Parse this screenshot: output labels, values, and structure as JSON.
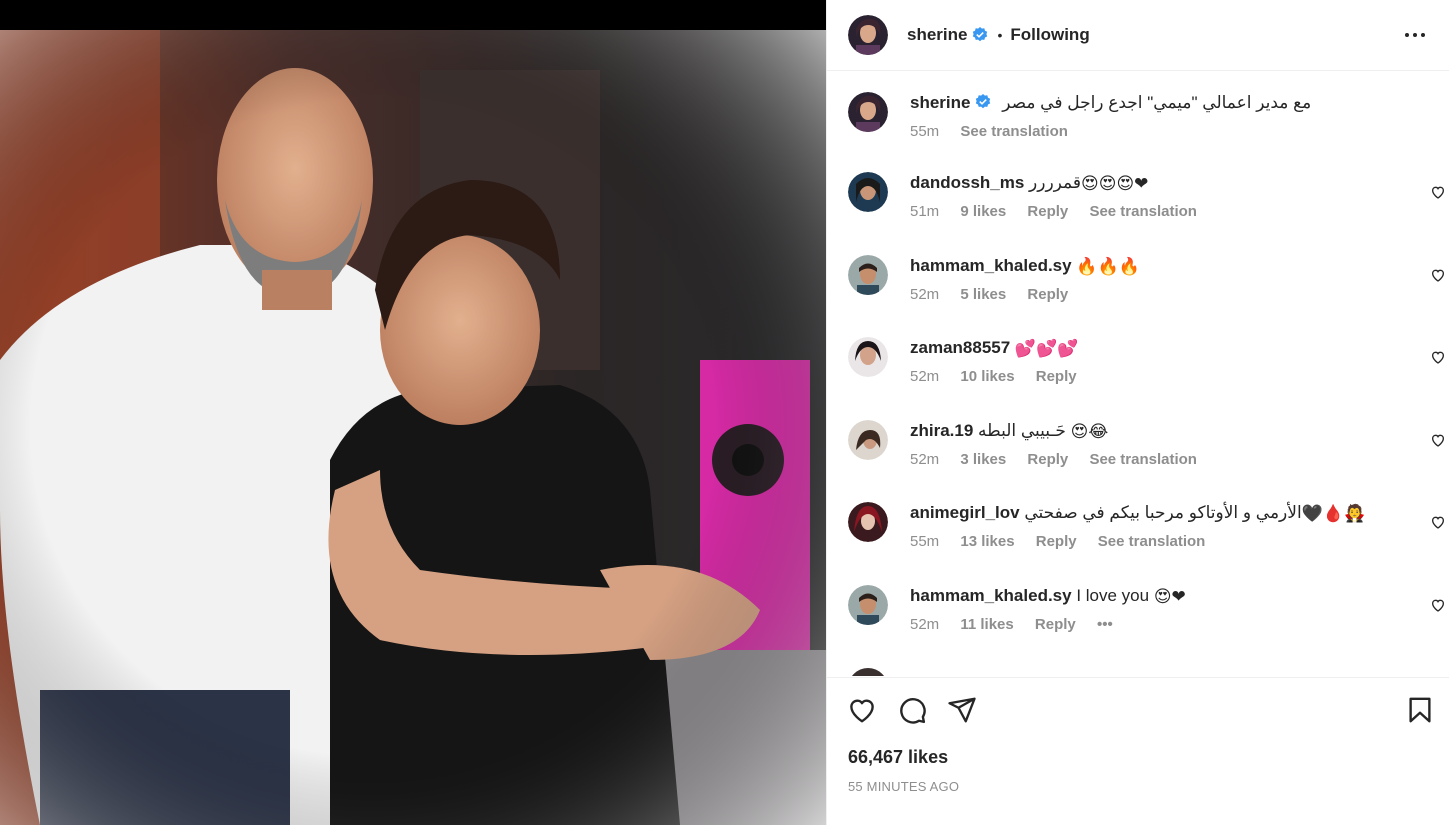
{
  "post": {
    "username": "sherine",
    "follow_status": "Following",
    "separator": "•",
    "caption": "مع مدير اعمالي \"ميمي\" اجدع راجل في مصر",
    "caption_time": "55m",
    "see_translation": "See translation",
    "likes": "66,467 likes",
    "posted_ago": "55 MINUTES AGO"
  },
  "comments": [
    {
      "user": "dandossh_ms",
      "text": "قمرررر",
      "emoji": "😍😍😍❤",
      "time": "51m",
      "likes": "9 likes",
      "reply": "Reply",
      "translate": "See translation"
    },
    {
      "user": "hammam_khaled.sy",
      "text": "",
      "emoji": "🔥🔥🔥",
      "time": "52m",
      "likes": "5 likes",
      "reply": "Reply",
      "translate": ""
    },
    {
      "user": "zaman88557",
      "text": "",
      "emoji": "💕💕💕",
      "time": "52m",
      "likes": "10 likes",
      "reply": "Reply",
      "translate": ""
    },
    {
      "user": "zhira.19",
      "text": "حَـبيبي البطه",
      "emoji": "😍😂",
      "time": "52m",
      "likes": "3 likes",
      "reply": "Reply",
      "translate": "See translation"
    },
    {
      "user": "animegirl_lov",
      "text": "الأرمي و الأوتاكو مرحبا بيكم في صفحتي",
      "emoji": "🖤🩸🧛",
      "time": "55m",
      "likes": "13 likes",
      "reply": "Reply",
      "translate": "See translation"
    },
    {
      "user": "hammam_khaled.sy",
      "text": "I love you",
      "emoji": "😍❤",
      "time": "52m",
      "likes": "11 likes",
      "reply": "Reply",
      "translate": "•••"
    }
  ],
  "icons": {
    "verified": "verified-badge-icon",
    "more": "more-options-icon",
    "like": "heart-icon",
    "comment": "comment-icon",
    "share": "share-icon",
    "save": "bookmark-icon"
  },
  "colors": {
    "verified": "#3897f0",
    "text": "#262626",
    "secondary": "#8e8e8e",
    "border": "#efefef"
  }
}
